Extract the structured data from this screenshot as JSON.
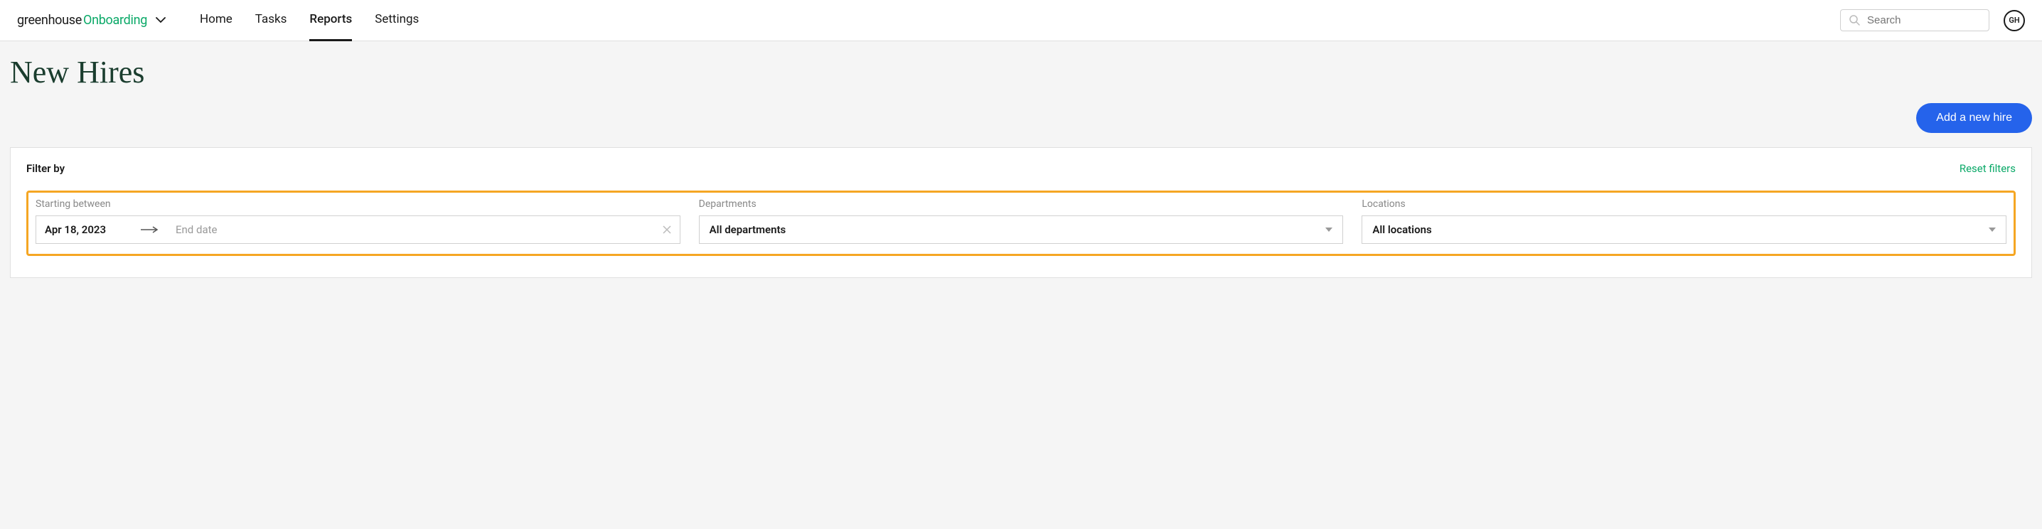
{
  "logo": {
    "part1": "greenhouse",
    "part2": "Onboarding"
  },
  "nav": {
    "items": [
      {
        "label": "Home"
      },
      {
        "label": "Tasks"
      },
      {
        "label": "Reports"
      },
      {
        "label": "Settings"
      }
    ]
  },
  "search": {
    "placeholder": "Search"
  },
  "avatar": {
    "initials": "GH"
  },
  "page": {
    "title": "New Hires"
  },
  "actions": {
    "add_new_hire": "Add a new hire"
  },
  "filters": {
    "header": "Filter by",
    "reset": "Reset filters",
    "starting_between": {
      "label": "Starting between",
      "start_date": "Apr 18, 2023",
      "end_placeholder": "End date"
    },
    "departments": {
      "label": "Departments",
      "value": "All departments"
    },
    "locations": {
      "label": "Locations",
      "value": "All locations"
    }
  }
}
